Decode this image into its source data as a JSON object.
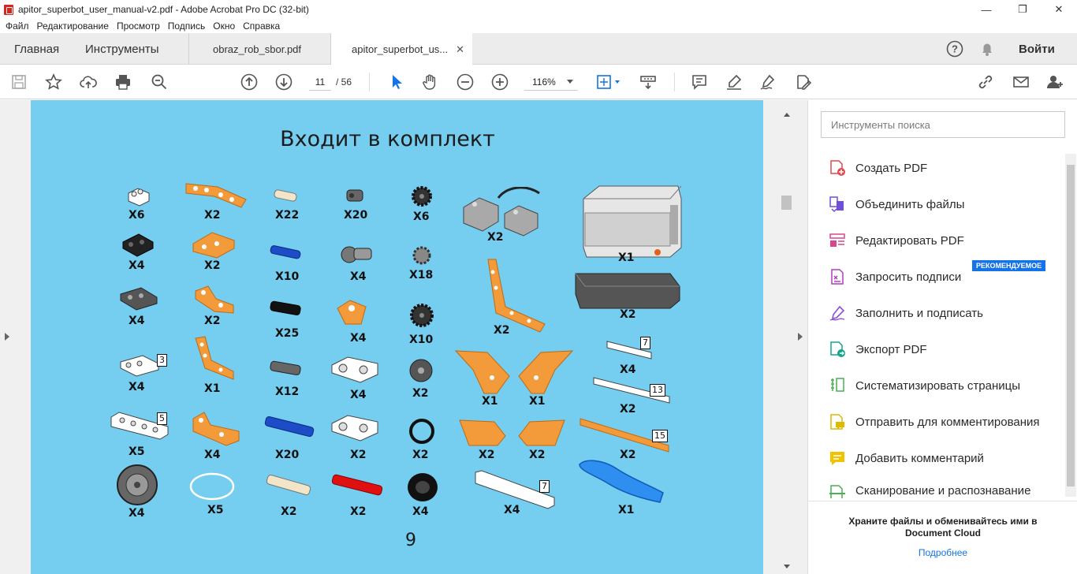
{
  "window": {
    "title": "apitor_superbot_user_manual-v2.pdf - Adobe Acrobat Pro DC (32-bit)",
    "minimize": "—",
    "restore": "❐",
    "close": "✕"
  },
  "menu": [
    "Файл",
    "Редактирование",
    "Просмотр",
    "Подпись",
    "Окно",
    "Справка"
  ],
  "tabs": {
    "home": "Главная",
    "tools": "Инструменты",
    "doc1": "obraz_rob_sbor.pdf",
    "doc2": "apitor_superbot_us...",
    "close": "✕",
    "signin": "Войти"
  },
  "toolbar": {
    "page_current": "11",
    "page_total": "/ 56",
    "zoom": "116%"
  },
  "document": {
    "title": "Входит в комплект",
    "page_number": "9",
    "parts": [
      "X6",
      "X2",
      "X22",
      "X20",
      "X6",
      "X2",
      "X1",
      "X4",
      "X2",
      "X10",
      "X4",
      "X18",
      "X4",
      "X2",
      "X25",
      "X4",
      "X10",
      "X2",
      "X2",
      "X4",
      "X1",
      "X12",
      "X4",
      "X2",
      "X1",
      "X1",
      "X4",
      "X2",
      "X5",
      "X4",
      "X20",
      "X2",
      "X2",
      "X2",
      "X2",
      "X2",
      "X4",
      "X5",
      "X2",
      "X2",
      "X4",
      "X4",
      "X1"
    ],
    "badges": [
      "3",
      "5",
      "7",
      "13",
      "15",
      "7"
    ]
  },
  "right_panel": {
    "search_placeholder": "Инструменты поиска",
    "tools": [
      "Создать PDF",
      "Объединить файлы",
      "Редактировать PDF",
      "Запросить подписи",
      "Заполнить и подписать",
      "Экспорт PDF",
      "Систематизировать страницы",
      "Отправить для комментирования",
      "Добавить комментарий",
      "Сканирование и распознавание"
    ],
    "recommended": "РЕКОМЕНДУЕМОЕ",
    "cloud_text": "Храните файлы и обменивайтесь ими в Document Cloud",
    "cloud_link": "Подробнее"
  },
  "colors": {
    "page_bg": "#75cdef",
    "accent": "#1473e6",
    "orange": "#f39a3a"
  }
}
